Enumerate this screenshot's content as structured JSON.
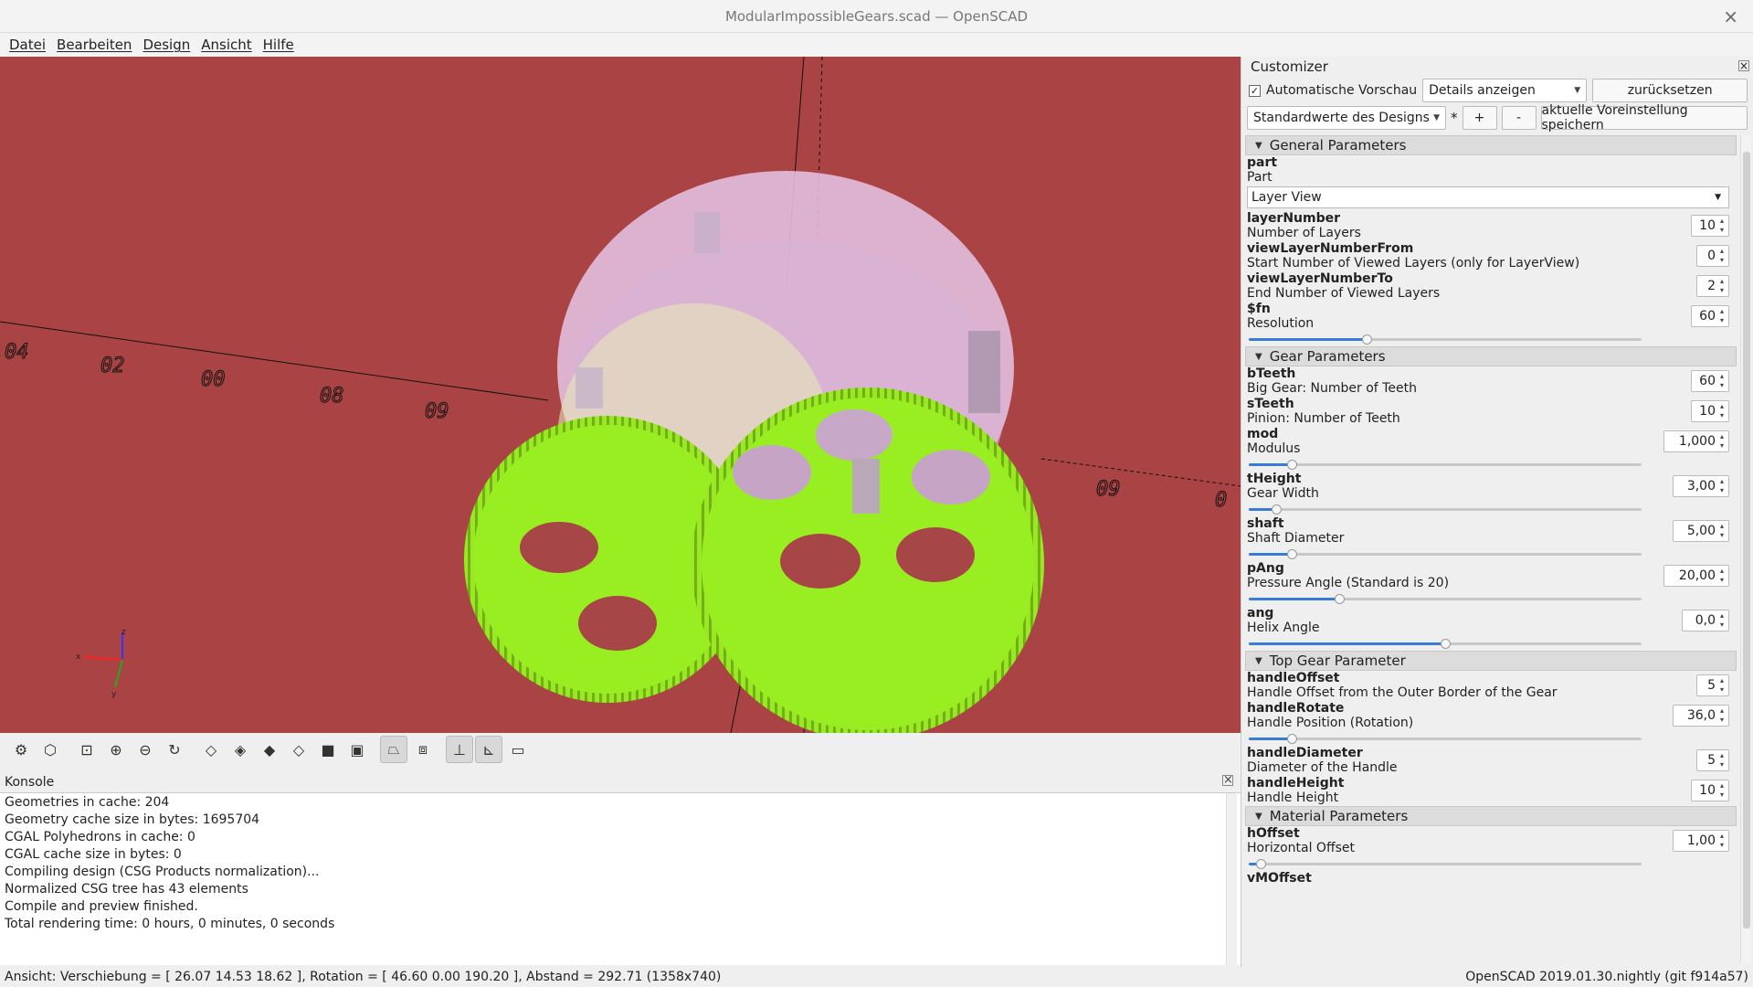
{
  "window": {
    "title": "ModularImpossibleGears.scad — OpenSCAD"
  },
  "menu": [
    "Datei",
    "Bearbeiten",
    "Design",
    "Ansicht",
    "Hilfe"
  ],
  "viewport": {
    "axis_labels": [
      "04",
      "02",
      "00",
      "08",
      "09",
      "09",
      "0"
    ],
    "axis_gizmo": {
      "x": "x",
      "y": "y",
      "z": "z"
    },
    "colors": {
      "background": "#aa4444",
      "gear": "#99ee22",
      "ghost": "#e6c6e6"
    }
  },
  "toolbar": [
    "render-icon",
    "preview-icon",
    "view-all-icon",
    "zoom-in-icon",
    "zoom-out-icon",
    "reset-view-icon",
    "view-right-icon",
    "view-top-icon",
    "view-bottom-icon",
    "view-left-icon",
    "view-front-icon",
    "view-back-icon",
    "perspective-icon",
    "orthogonal-icon",
    "show-axes-icon",
    "show-scale-icon",
    "show-edges-icon"
  ],
  "console": {
    "title": "Konsole",
    "lines": [
      "Geometries in cache: 204",
      "Geometry cache size in bytes: 1695704",
      "CGAL Polyhedrons in cache: 0",
      "CGAL cache size in bytes: 0",
      "Compiling design (CSG Products normalization)...",
      "Normalized CSG tree has 43 elements",
      "Compile and preview finished.",
      "Total rendering time: 0 hours, 0 minutes, 0 seconds"
    ]
  },
  "status": {
    "left": "Ansicht: Verschiebung = [ 26.07 14.53 18.62 ], Rotation = [ 46.60 0.00 190.20 ], Abstand = 292.71 (1358x740)",
    "right": "OpenSCAD 2019.01.30.nightly (git f914a57)"
  },
  "customizer": {
    "title": "Customizer",
    "auto_preview_label": "Automatische Vorschau",
    "auto_preview_checked": true,
    "details_select": "Details anzeigen",
    "reset_button": "zurücksetzen",
    "preset_select": "Standardwerte des Designs",
    "modified_marker": "*",
    "add_button": "+",
    "remove_button": "-",
    "save_preset_button": "aktuelle Voreinstellung speichern",
    "groups": [
      {
        "title": "General Parameters",
        "params": [
          {
            "name": "part",
            "desc": "Part",
            "type": "dropdown",
            "value": "Layer View"
          },
          {
            "name": "layerNumber",
            "desc": "Number of Layers",
            "type": "spin",
            "value": "10"
          },
          {
            "name": "viewLayerNumberFrom",
            "desc": "Start Number of Viewed Layers (only for LayerView)",
            "type": "spin",
            "value": "0"
          },
          {
            "name": "viewLayerNumberTo",
            "desc": "End Number of Viewed Layers",
            "type": "spin",
            "value": "2"
          },
          {
            "name": "$fn",
            "desc": "Resolution",
            "type": "slider",
            "value": "60",
            "level": 0.3
          }
        ]
      },
      {
        "title": "Gear Parameters",
        "params": [
          {
            "name": "bTeeth",
            "desc": "Big Gear: Number of Teeth",
            "type": "spin",
            "value": "60"
          },
          {
            "name": "sTeeth",
            "desc": "Pinion: Number of Teeth",
            "type": "spin",
            "value": "10"
          },
          {
            "name": "mod",
            "desc": "Modulus",
            "type": "slider",
            "value": "1,000",
            "level": 0.11
          },
          {
            "name": "tHeight",
            "desc": "Gear Width",
            "type": "slider",
            "value": "3,00",
            "level": 0.07
          },
          {
            "name": "shaft",
            "desc": "Shaft Diameter",
            "type": "slider",
            "value": "5,00",
            "level": 0.11
          },
          {
            "name": "pAng",
            "desc": "Pressure Angle (Standard is 20)",
            "type": "slider",
            "value": "20,00",
            "level": 0.23
          },
          {
            "name": "ang",
            "desc": "Helix Angle",
            "type": "slider",
            "value": "0,0",
            "level": 0.5
          }
        ]
      },
      {
        "title": "Top Gear Parameter",
        "params": [
          {
            "name": "handleOffset",
            "desc": "Handle Offset from the Outer Border of the Gear",
            "type": "spin",
            "value": "5"
          },
          {
            "name": "handleRotate",
            "desc": "Handle Position (Rotation)",
            "type": "slider",
            "value": "36,0",
            "level": 0.11
          },
          {
            "name": "handleDiameter",
            "desc": "Diameter of the Handle",
            "type": "spin",
            "value": "5"
          },
          {
            "name": "handleHeight",
            "desc": "Handle Height",
            "type": "spin",
            "value": "10"
          }
        ]
      },
      {
        "title": "Material Parameters",
        "params": [
          {
            "name": "hOffset",
            "desc": "Horizontal Offset",
            "type": "slider",
            "value": "1,00",
            "level": 0.03
          },
          {
            "name": "vMOffset",
            "desc": "",
            "type": "name-only",
            "value": ""
          }
        ]
      }
    ]
  }
}
